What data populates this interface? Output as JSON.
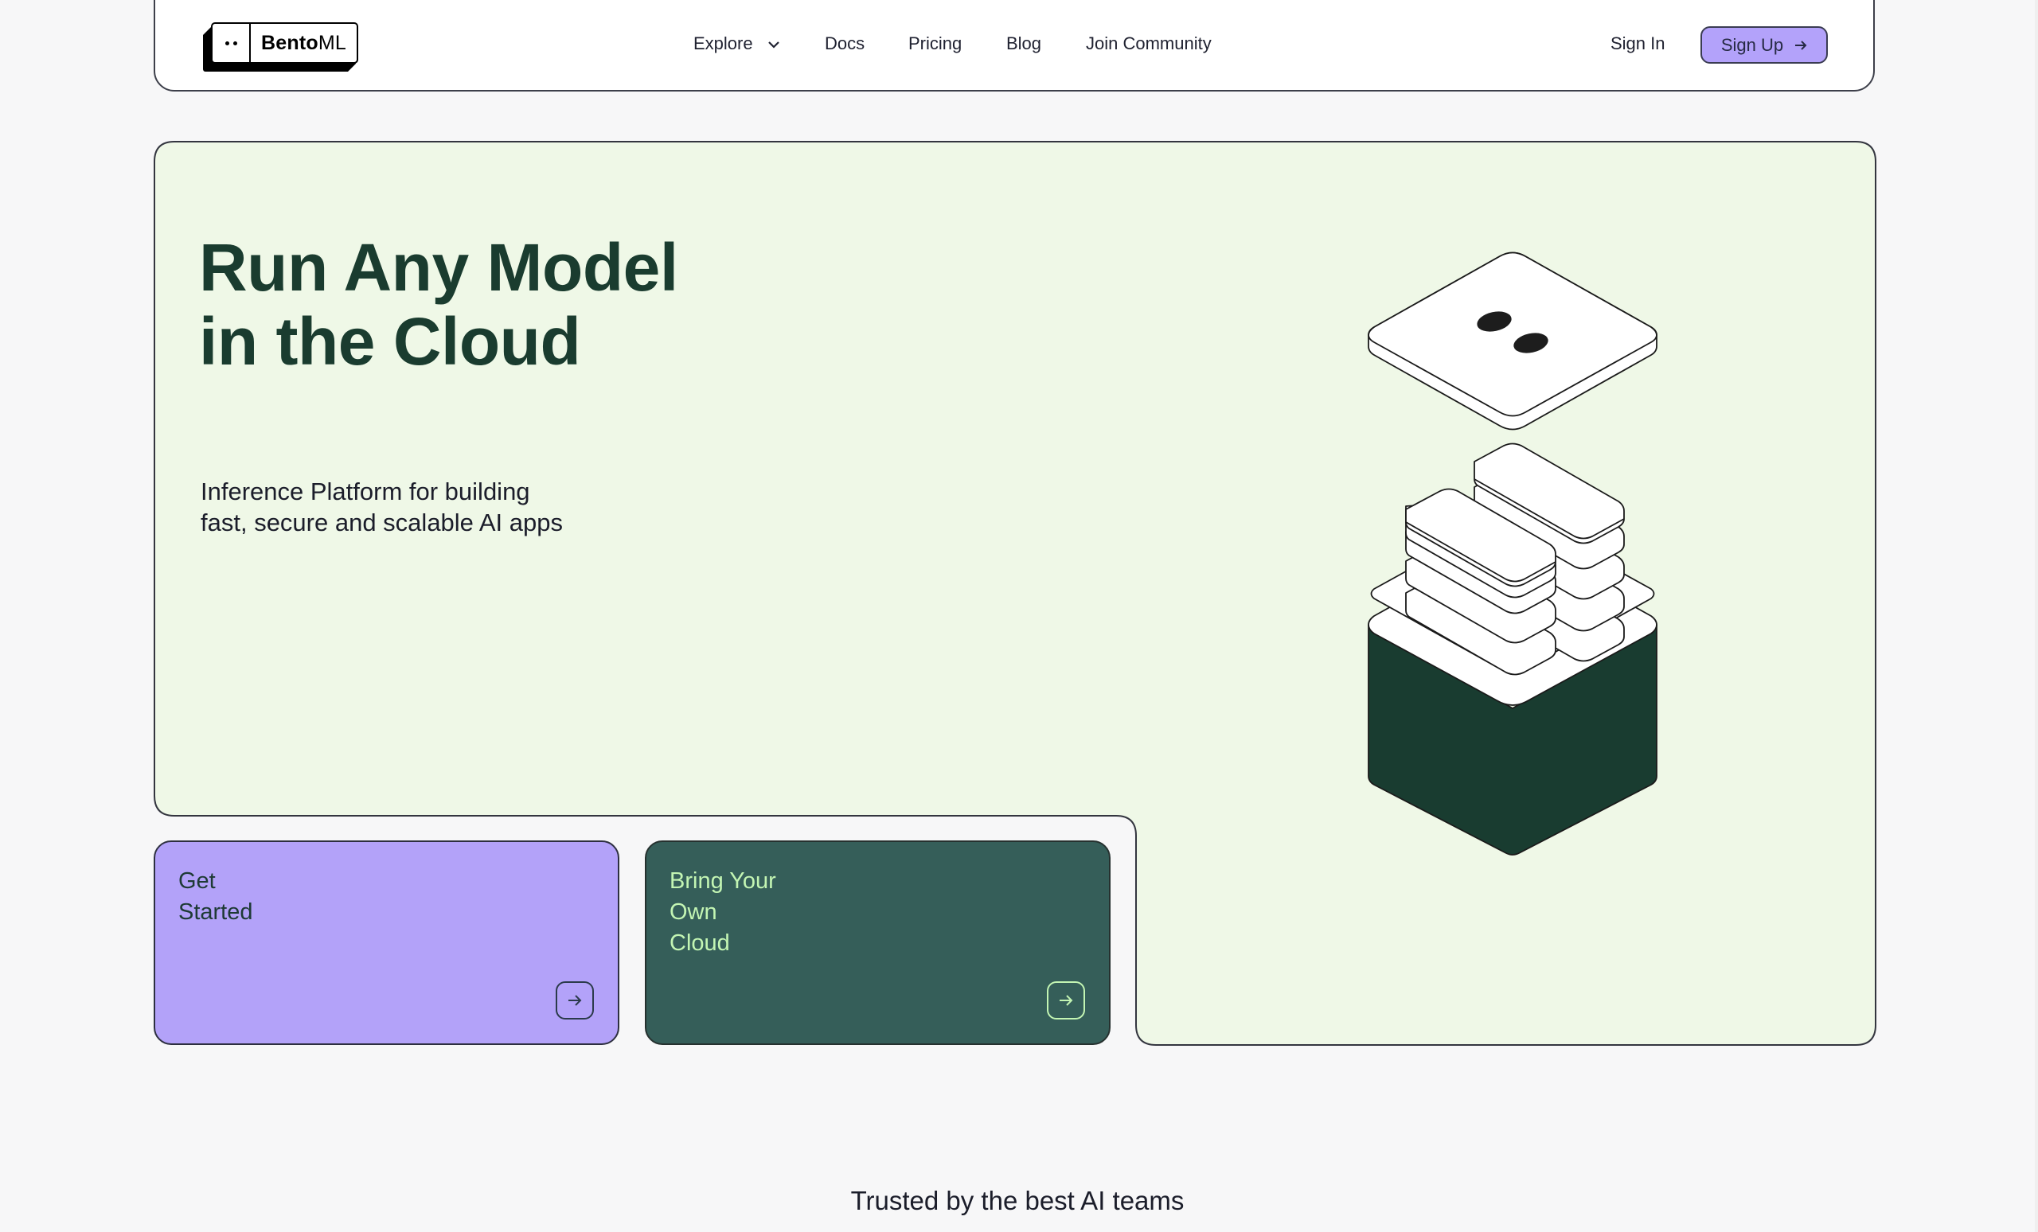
{
  "brand": {
    "name_bold": "Bento",
    "name_light": "ML",
    "logo_icon": "two-dots-eyes"
  },
  "nav": {
    "items": [
      {
        "label": "Explore",
        "has_dropdown": true
      },
      {
        "label": "Docs"
      },
      {
        "label": "Pricing"
      },
      {
        "label": "Blog"
      },
      {
        "label": "Join Community"
      }
    ],
    "sign_in": "Sign In",
    "sign_up": "Sign Up",
    "sign_up_icon": "arrow-right-icon"
  },
  "hero": {
    "title_line1": "Run Any Model",
    "title_line2": "in the Cloud",
    "subtitle_line1": "Inference Platform for building",
    "subtitle_line2": "fast, secure and scalable AI apps",
    "illustration": "isometric-bento-box"
  },
  "cards": [
    {
      "lines": [
        "Get",
        "Started"
      ],
      "icon": "arrow-right-icon"
    },
    {
      "lines": [
        "Bring Your",
        "Own",
        "Cloud"
      ],
      "icon": "arrow-right-icon"
    }
  ],
  "trusted": {
    "heading": "Trusted by the best AI teams"
  },
  "colors": {
    "hero_bg": "#eff8e7",
    "title": "#1a3c2f",
    "purple": "#b3a2f9",
    "dark_green_card": "#355e59",
    "box_green": "#193c30",
    "light_green_text": "#c3f5b3",
    "page_bg": "#f7f7f8"
  }
}
